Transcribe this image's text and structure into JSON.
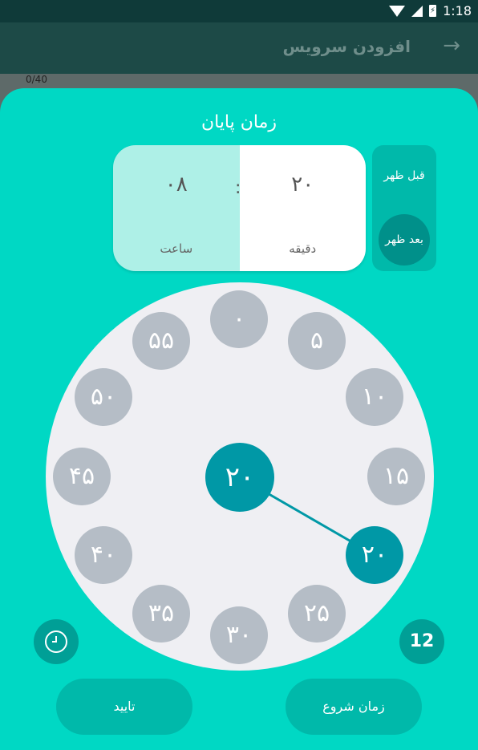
{
  "status_bar": {
    "time": "1:18"
  },
  "app_bar": {
    "title": "افزودن سرویس",
    "back_icon": "arrow-right-icon"
  },
  "counter": "0/40",
  "picker": {
    "title": "زمان پایان",
    "hour_value": "۰۸",
    "hour_label": "ساعت",
    "minute_value": "۲۰",
    "minute_label": "دقیقه",
    "separator": ":",
    "am_label": "قبل ظهر",
    "pm_label": "بعد ظهر",
    "selected_period": "pm",
    "center_value": "۲۰",
    "selected_tick": "۲۰",
    "ticks": [
      "۰",
      "۵",
      "۱۰",
      "۱۵",
      "۲۰",
      "۲۵",
      "۳۰",
      "۳۵",
      "۴۰",
      "۴۵",
      "۵۰",
      "۵۵"
    ],
    "format_button": "12",
    "confirm_button": "تایید",
    "start_time_button": "زمان شروع"
  },
  "colors": {
    "accent": "#00d8c4",
    "selected": "#0098a6",
    "tick_bg": "#b5bdc6",
    "dial_bg": "#efeff3"
  }
}
